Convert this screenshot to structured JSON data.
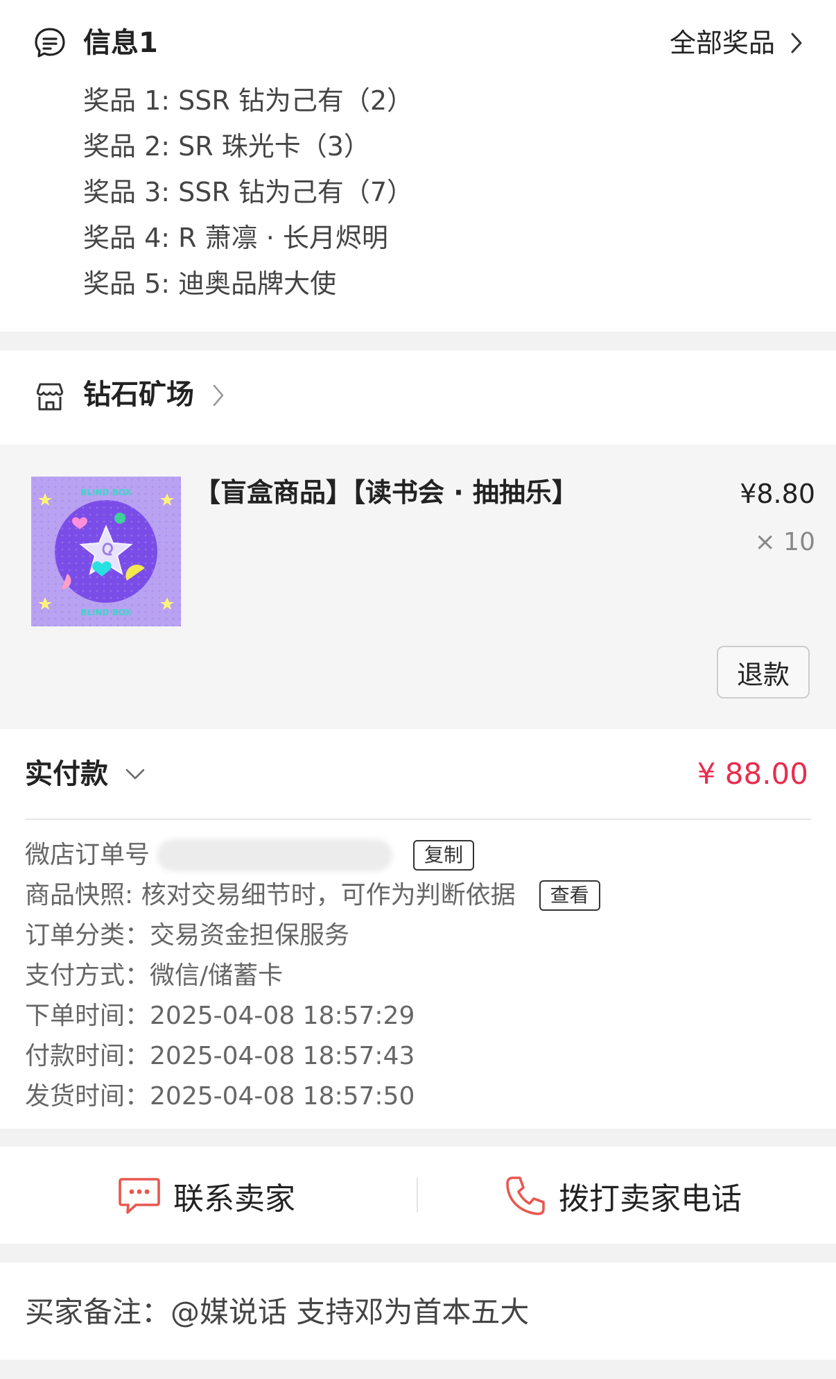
{
  "prize_section": {
    "title": "信息1",
    "all_prizes_label": "全部奖品",
    "items": [
      "奖品 1: SSR 钻为己有（2）",
      "奖品 2: SR 珠光卡（3）",
      "奖品 3: SSR 钻为己有（7）",
      "奖品 4: R 萧凛 · 长月烬明",
      "奖品 5: 迪奥品牌大使"
    ]
  },
  "shop": {
    "name": "钻石矿场"
  },
  "product": {
    "title": "【盲盒商品】【读书会 · 抽抽乐】",
    "price": "¥8.80",
    "quantity": "× 10",
    "refund_label": "退款",
    "thumb_text_top": "BLIND BOX",
    "thumb_text_bottom": "BLIND BOX"
  },
  "payment": {
    "paid_label": "实付款",
    "paid_amount": "¥ 88.00",
    "order_no_label": "微店订单号",
    "copy_label": "复制",
    "snapshot_text": "商品快照: 核对交易细节时，可作为判断依据",
    "view_label": "查看",
    "rows": [
      {
        "label": "订单分类：",
        "value": "交易资金担保服务"
      },
      {
        "label": "支付方式：",
        "value": "微信/储蓄卡"
      },
      {
        "label": "下单时间：",
        "value": "2025-04-08 18:57:29"
      },
      {
        "label": "付款时间：",
        "value": "2025-04-08 18:57:43"
      },
      {
        "label": "发货时间：",
        "value": "2025-04-08 18:57:50"
      }
    ]
  },
  "contact": {
    "chat_label": "联系卖家",
    "call_label": "拨打卖家电话"
  },
  "remark": {
    "text": "买家备注：@媒说话 支持邓为首本五大"
  },
  "colors": {
    "accent_red": "#e82d4f",
    "icon_red": "#e8574f",
    "thumb_purple": "#b49cf0"
  }
}
